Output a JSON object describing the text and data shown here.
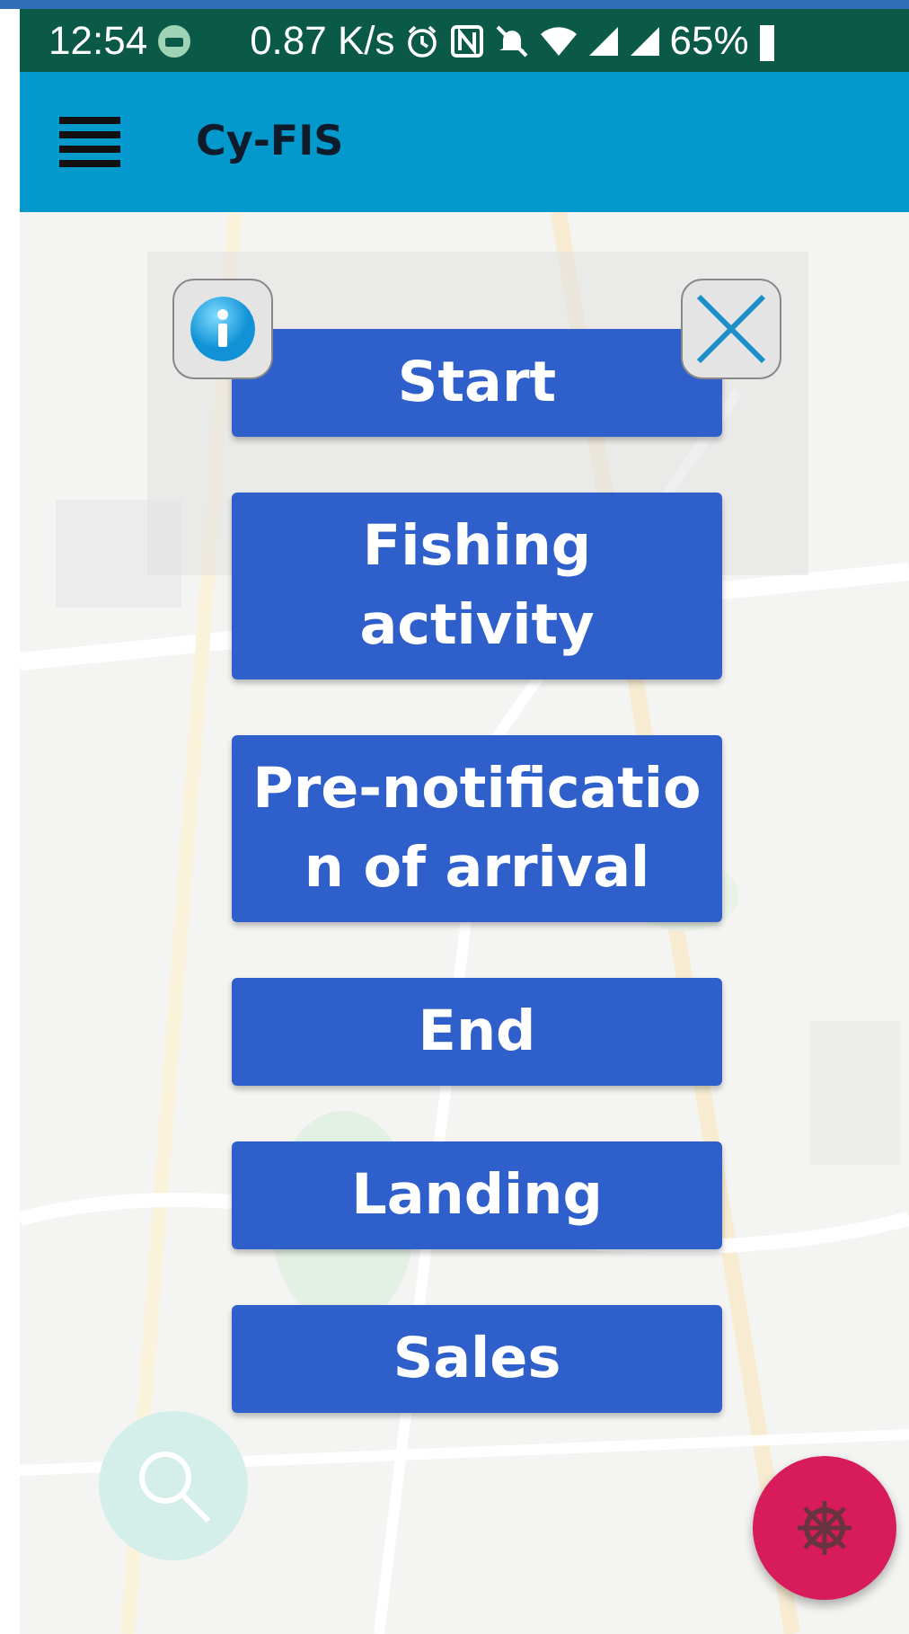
{
  "status_bar": {
    "time": "12:54",
    "speed": "0.87 K/s",
    "battery": "65%"
  },
  "app_bar": {
    "title": "Cy-FIS"
  },
  "menu": {
    "buttons": [
      {
        "lines": [
          "Start"
        ]
      },
      {
        "lines": [
          "Fishing",
          "activity"
        ]
      },
      {
        "lines": [
          "Pre-notificatio",
          "n of arrival"
        ]
      },
      {
        "lines": [
          "End"
        ]
      },
      {
        "lines": [
          "Landing"
        ]
      },
      {
        "lines": [
          "Sales"
        ]
      }
    ]
  }
}
